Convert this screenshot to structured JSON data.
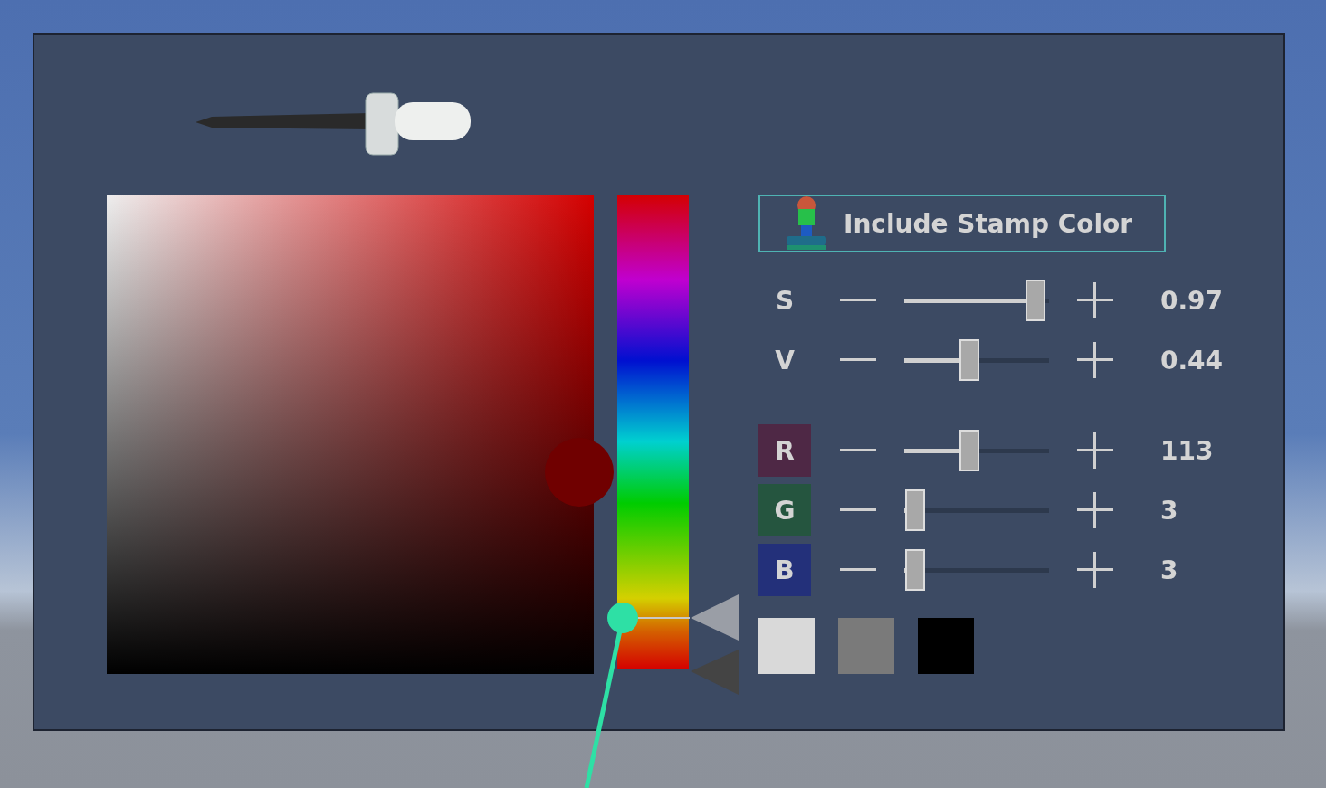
{
  "stamp_toggle": {
    "label": "Include Stamp Color",
    "on": true
  },
  "sliders": [
    {
      "kind": "hsv",
      "label": "S",
      "level": 0.97,
      "reading": "0.97"
    },
    {
      "kind": "hsv",
      "label": "V",
      "level": 0.44,
      "reading": "0.44"
    },
    {
      "kind": "rgb",
      "label": "R",
      "color": "#4e2845",
      "level": 0.44,
      "reading": "113"
    },
    {
      "kind": "rgb",
      "label": "G",
      "color": "#25553f",
      "level": 0.01,
      "reading": "3"
    },
    {
      "kind": "rgb",
      "label": "B",
      "color": "#23307a",
      "level": 0.01,
      "reading": "3"
    }
  ],
  "swatches": [
    {
      "color": "#d9d9d9"
    },
    {
      "color": "#7a7a7a"
    },
    {
      "color": "#000000"
    }
  ]
}
